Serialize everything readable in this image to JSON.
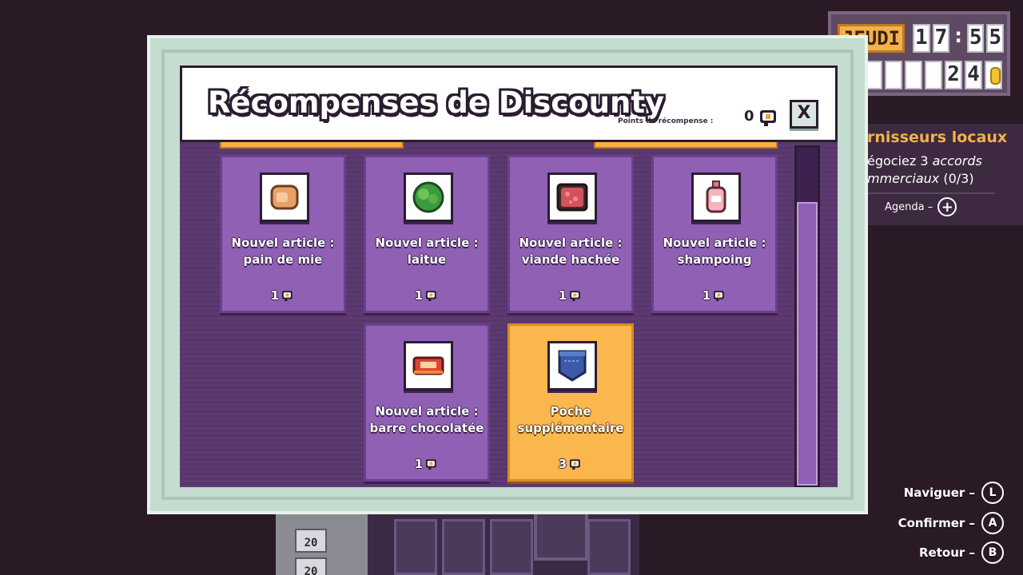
{
  "hud": {
    "day": "JEUDI",
    "time_digits": [
      "1",
      "7",
      "5",
      "5"
    ],
    "time_separator": ":",
    "money_digits": [
      "",
      "",
      "",
      "",
      "2",
      "4"
    ]
  },
  "quest": {
    "title": "rnisseurs locaux",
    "desc_line1_prefix": "égociez 3 ",
    "desc_line1_italic": "accords",
    "desc_line2_italic": "mmerciaux",
    "desc_line2_suffix": " (0/3)",
    "agenda_label": "Agenda –"
  },
  "dialog": {
    "title": "Récompenses de Discounty",
    "points_label": "Points de récompense :",
    "points_value": "0",
    "close_label": "X"
  },
  "rewards": [
    {
      "line1": "Nouvel article :",
      "line2": "pain de mie",
      "cost": "1",
      "icon": "bread-icon",
      "selected": false
    },
    {
      "line1": "Nouvel article :",
      "line2": "laitue",
      "cost": "1",
      "icon": "lettuce-icon",
      "selected": false
    },
    {
      "line1": "Nouvel article :",
      "line2": "viande hachée",
      "cost": "1",
      "icon": "minced-meat-icon",
      "selected": false
    },
    {
      "line1": "Nouvel article :",
      "line2": "shampoing",
      "cost": "1",
      "icon": "shampoo-icon",
      "selected": false
    },
    {
      "line1": "Nouvel article :",
      "line2": "barre chocolatée",
      "cost": "1",
      "icon": "chocolate-bar-icon",
      "selected": false
    },
    {
      "line1": "Poche",
      "line2": "supplémentaire",
      "cost": "3",
      "icon": "pocket-icon",
      "selected": true
    }
  ],
  "controls": [
    {
      "label": "Naviguer –",
      "glyph": "L",
      "icon": "left-stick-icon"
    },
    {
      "label": "Confirmer –",
      "glyph": "A",
      "icon": "a-button-icon"
    },
    {
      "label": "Retour –",
      "glyph": "B",
      "icon": "b-button-icon"
    }
  ],
  "background": {
    "shelf_tags": [
      "20",
      "20"
    ]
  },
  "colors": {
    "accent": "#f9b74e",
    "card": "#9060b4",
    "panel": "#5d3a73",
    "frame": "#c5dcd1"
  }
}
